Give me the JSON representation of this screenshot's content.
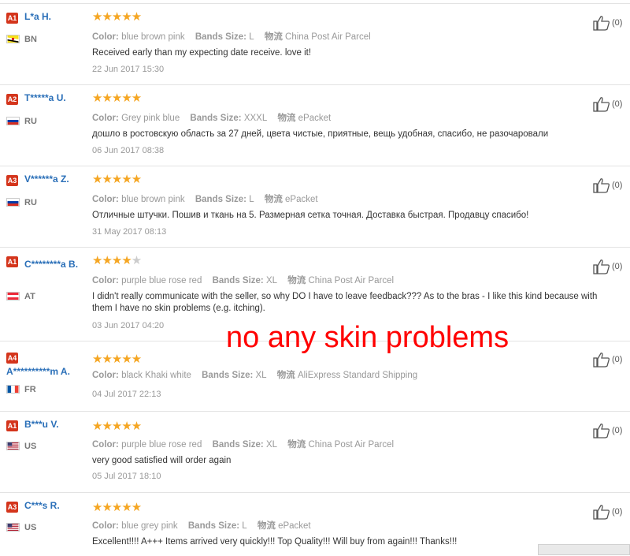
{
  "labels": {
    "color": "Color:",
    "bands_size": "Bands Size:",
    "logistics": "物流"
  },
  "reviews": [
    {
      "level": "A1",
      "name": "L*a H.",
      "country": "BN",
      "stars": 5,
      "color": "blue brown pink",
      "size": "L",
      "shipping": "China Post Air Parcel",
      "feedback": "Received early than my expecting date receive. love it!",
      "date": "22 Jun 2017 15:30",
      "likes": "(0)"
    },
    {
      "level": "A2",
      "name": "T*****a U.",
      "country": "RU",
      "stars": 5,
      "color": "Grey pink blue",
      "size": "XXXL",
      "shipping": "ePacket",
      "feedback": "дошло в ростовскую область за 27 дней, цвета чистые, приятные, вещь удобная, спасибо, не разочаровали",
      "date": "06 Jun 2017 08:38",
      "likes": "(0)"
    },
    {
      "level": "A3",
      "name": "V******a Z.",
      "country": "RU",
      "stars": 5,
      "color": "blue brown pink",
      "size": "L",
      "shipping": "ePacket",
      "feedback": "Отличные штучки. Пошив и ткань на 5. Размерная сетка точная. Доставка быстрая. Продавцу спасибо!",
      "date": "31 May 2017 08:13",
      "likes": "(0)"
    },
    {
      "level": "A1",
      "name": "C********a B.",
      "country": "AT",
      "stars": 4,
      "color": "purple blue rose red",
      "size": "XL",
      "shipping": "China Post Air Parcel",
      "feedback": "I didn't really communicate with the seller, so why DO I have to leave feedback??? As to the bras - I like this kind because with them I have no skin problems (e.g. itching).",
      "date": "03 Jun 2017 04:20",
      "likes": "(0)"
    },
    {
      "level": "A4",
      "name": "A**********m A.",
      "country": "FR",
      "stars": 5,
      "color": "black Khaki white",
      "size": "XL",
      "shipping": "AliExpress Standard Shipping",
      "feedback": "",
      "date": "04 Jul 2017 22:13",
      "likes": "(0)"
    },
    {
      "level": "A1",
      "name": "B***u V.",
      "country": "US",
      "stars": 5,
      "color": "purple blue rose red",
      "size": "XL",
      "shipping": "China Post Air Parcel",
      "feedback": "very good satisfied will order again",
      "date": "05 Jul 2017 18:10",
      "likes": "(0)"
    },
    {
      "level": "A3",
      "name": "C***s R.",
      "country": "US",
      "stars": 5,
      "color": "blue grey pink",
      "size": "L",
      "shipping": "ePacket",
      "feedback": "Excellent!!!! A+++ Items arrived very quickly!!! Top Quality!!! Will buy from again!!! Thanks!!!",
      "date": "",
      "likes": "(0)"
    }
  ],
  "overlay_text": "no any skin problems",
  "icons": {
    "like": "thumbs-up-icon",
    "flag": "country-flag-icon"
  },
  "colors": {
    "accent": "#f5a623",
    "name": "#2a6fb8",
    "level_badge": "#d4351c",
    "overlay": "#ff0000"
  }
}
